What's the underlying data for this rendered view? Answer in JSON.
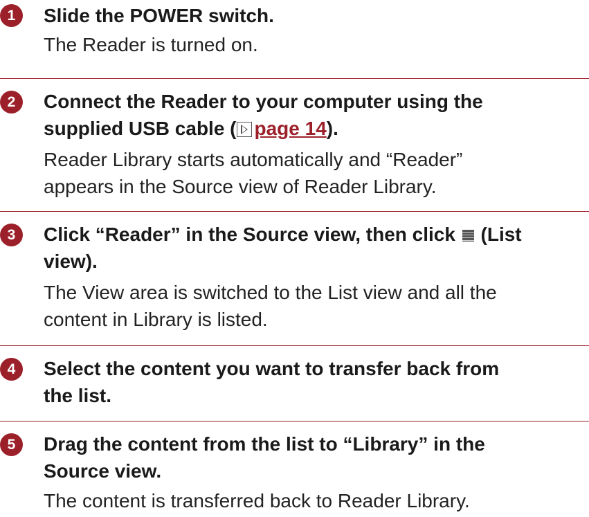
{
  "steps": [
    {
      "number": "1",
      "title": "Slide the POWER switch.",
      "description_lines": [
        "The Reader is turned on."
      ]
    },
    {
      "number": "2",
      "title_line1": "Connect the Reader to your computer using the",
      "title_line2_prefix": "supplied USB cable (",
      "title_link": "page 14",
      "title_line2_suffix": ").",
      "description_lines": [
        "Reader Library starts automatically and “Reader”",
        "appears in the Source view of Reader Library."
      ]
    },
    {
      "number": "3",
      "title_line1_prefix": "Click “Reader” in the Source view, then click",
      "title_line1_suffix": "(List",
      "title_line2": "view).",
      "icon": "list-view-icon",
      "description_lines": [
        "The View area is switched to the List view and all the",
        "content in Library is listed."
      ]
    },
    {
      "number": "4",
      "title_line1": "Select the content you want to transfer back from",
      "title_line2": "the list."
    },
    {
      "number": "5",
      "title_line1": "Drag the content from the list to “Library” in the",
      "title_line2": "Source view.",
      "description_lines": [
        "The content is transferred back to Reader Library."
      ]
    }
  ],
  "accent_color": "#9c2029"
}
